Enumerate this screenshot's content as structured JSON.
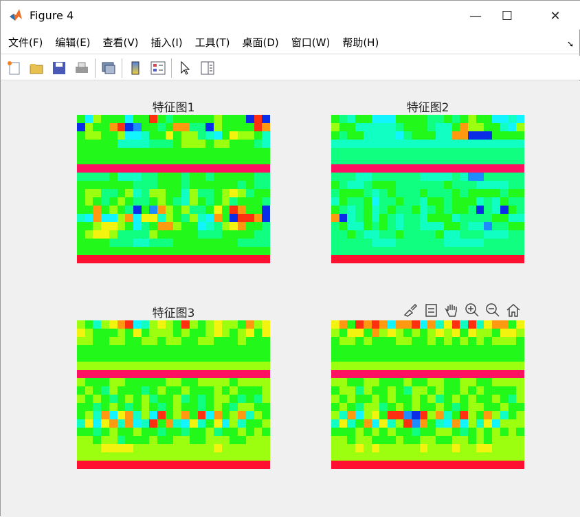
{
  "window": {
    "title": "Figure 4",
    "minimize": "—",
    "maximize": "☐",
    "close": "✕"
  },
  "menu": [
    "文件(F)",
    "编辑(E)",
    "查看(V)",
    "插入(I)",
    "工具(T)",
    "桌面(D)",
    "窗口(W)",
    "帮助(H)"
  ],
  "toolbar": [
    "new-file-icon",
    "open-folder-icon",
    "save-icon",
    "print-icon",
    "link-figure-icon",
    "colorbar-icon",
    "legend-icon",
    "pointer-icon",
    "property-inspector-icon"
  ],
  "modebar": [
    "brush-icon",
    "data-tips-icon",
    "pan-icon",
    "zoom-in-icon",
    "zoom-out-icon",
    "home-icon"
  ],
  "colors": {
    "0": "#0a2ee8",
    "1": "#1e8cff",
    "2": "#12f4ff",
    "3": "#12ffc4",
    "4": "#10ff80",
    "5": "#22f81a",
    "6": "#9cff10",
    "7": "#f2f410",
    "8": "#ff9a10",
    "9": "#ff3010",
    "p": "#ff1060",
    "r": "#ff1030"
  },
  "plots": [
    {
      "title": "特征图1",
      "rows": [
        "526555255954555556555090",
        "065589015545884406555598",
        "566556223557566432576653",
        "555553333444566656655543",
        "555555555555555555555555",
        "555555555555555555555555",
        "pppppppppppppppppppppppp",
        "444453334455545545555544",
        "555555544455545555554544",
        "566445634665536445676455",
        "565456544565436545645554",
        "558565405186564457598550",
        "328226827736546328509980",
        "556776524588655234678554",
        "567764444655555444555544",
        "555544433444555555554444",
        "555555555555555555555555",
        "rrrrrrrrrrrrrrrrrrrrrrrr"
      ]
    },
    {
      "title": "特征图2",
      "rows": [
        "543552225555445456552232",
        "655333334555433586655326",
        "545533332455533880005555",
        "333333333333333333333333",
        "444444444444444444444444",
        "444444444444444444444444",
        "pppppppppppppppppppppppp",
        "444334444443333431144444",
        "543345554444445444333344",
        "455543454445444545555455",
        "354452445443554555343544",
        "543453454453454554043054",
        "803453543443555344445533",
        "453354543443335543314455",
        "445433445444453344433344",
        "444443334444443333344444",
        "444444444444444444444444",
        "rrrrrrrrrrrrrrrrrrrrrrrr"
      ]
    },
    {
      "title": "特征图3",
      "rows": [
        "653678923676596567665867",
        "765556575666565567656757",
        "665566556656655665556555",
        "555555555555555555555555",
        "555555555555555555555555",
        "666666666666666666666666",
        "pppppppppppppppppppppppp",
        "655566555556655666656666",
        "565465554565565556565556",
        "656545656455645456654546",
        "554565456545655456546655",
        "563827836295685928568365",
        "372783823958327357263556",
        "554565565545545564556565",
        "665664555655665566655666",
        "666777766666666667666666",
        "666666666666666666666666",
        "rrrrrrrrrrrrrrrrrrrrrrrr"
      ]
    },
    {
      "title": "",
      "rows": [
        "785989828892837939378857",
        "657758676565676757665776",
        "566565556655656565656665",
        "555555555555555555555555",
        "555555555555555555555555",
        "666666666666666666666666",
        "pppppppppppppppppppppppp",
        "665566555655665566556666",
        "566465565466565565655556",
        "656556565565645656556546",
        "565466456565565456655655",
        "638267599109683596586356",
        "373582736918532826372666",
        "555656565545566545656565",
        "665665556556655665656666",
        "666767666667666766776666",
        "666666666666666666666666",
        "rrrrrrrrrrrrrrrrrrrrrrrr"
      ]
    }
  ]
}
